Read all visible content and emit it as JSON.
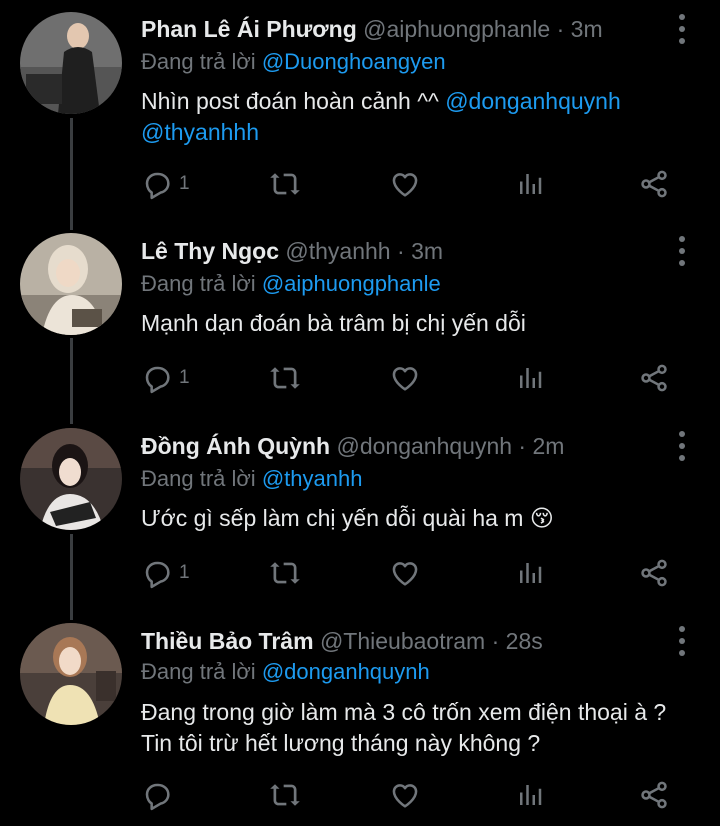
{
  "tweets": [
    {
      "name": "Phan Lê Ái Phương",
      "handle": "@aiphuongphanle",
      "time": "3m",
      "reply_prefix": "Đang trả lời",
      "reply_to": "@Duonghoangyen",
      "text": "Nhìn post đoán hoàn cảnh ^^",
      "mention1": "@donganhquynh",
      "mention2": "@thyanhhh",
      "reply_count": "1"
    },
    {
      "name": "Lê Thy Ngọc",
      "handle": "@thyanhh",
      "time": "3m",
      "reply_prefix": "Đang trả lời",
      "reply_to": "@aiphuongphanle",
      "text": "Mạnh dạn đoán bà trâm bị chị yến dỗi",
      "reply_count": "1"
    },
    {
      "name": "Đồng Ánh Quỳnh",
      "handle": "@donganhquynh",
      "time": "2m",
      "reply_prefix": "Đang trả lời",
      "reply_to": "@thyanhh",
      "text": "Ước gì sếp làm chị yến dỗi quài ha m 😚",
      "reply_count": "1"
    },
    {
      "name": "Thiều Bảo Trâm",
      "handle": "@Thieubaotram",
      "time": "28s",
      "reply_prefix": "Đang trả lời",
      "reply_to": "@donganhquynh",
      "text_line1": "Đang trong giờ làm mà 3 cô trốn xem điện thoại à ?",
      "text_line2": "Tin tôi trừ hết lương tháng này không ?",
      "reply_count": ""
    }
  ],
  "separator": "·",
  "icons": [
    "reply-icon",
    "retweet-icon",
    "like-icon",
    "views-icon",
    "share-icon",
    "more-icon"
  ],
  "colors": {
    "background": "#000000",
    "text": "#e7e9ea",
    "muted": "#71767b",
    "link": "#1d9bf0",
    "thread_line": "#3a3d40"
  }
}
